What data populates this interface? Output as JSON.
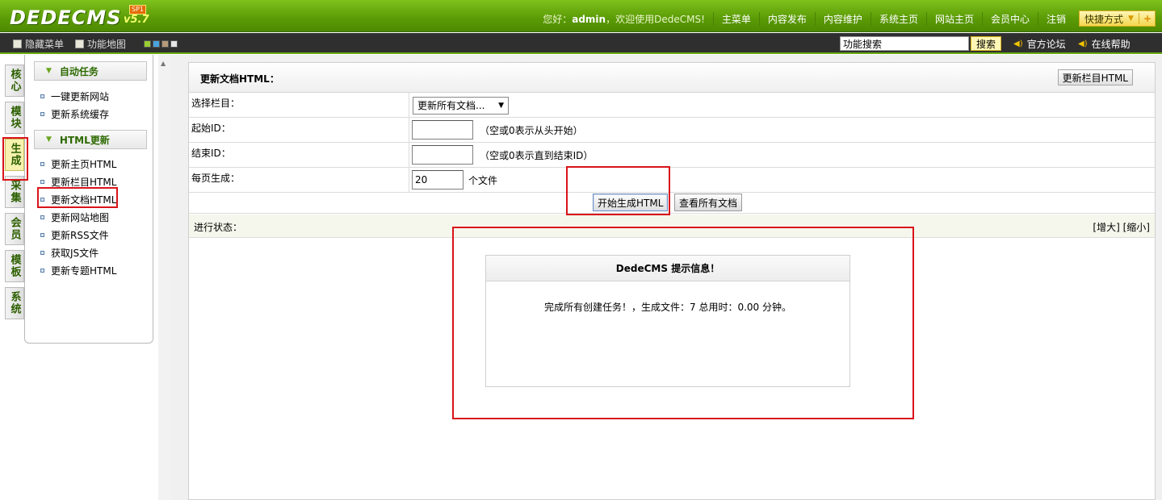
{
  "topbar": {
    "logo_text": "DEDECMS",
    "logo_version": "v5.7",
    "logo_badge": "SP1",
    "greeting_prefix": "您好：",
    "greeting_user": "admin",
    "greeting_suffix": "，欢迎使用DedeCMS!",
    "nav": [
      "主菜单",
      "内容发布",
      "内容维护",
      "系统主页",
      "网站主页",
      "会员中心",
      "注销"
    ],
    "quick_label": "快捷方式"
  },
  "subbar": {
    "hide_menu": "隐藏菜单",
    "func_map": "功能地图",
    "skin_colors": [
      "#9acd32",
      "#4aa3df",
      "#b59a7a",
      "#e6e6e6"
    ],
    "search_value": "功能搜索",
    "search_button": "搜索",
    "forum": "官方论坛",
    "help": "在线帮助"
  },
  "vtabs": [
    "核心",
    "模块",
    "生成",
    "采集",
    "会员",
    "模板",
    "系统"
  ],
  "active_vtab": "生成",
  "menu": {
    "groups": [
      {
        "title": "自动任务",
        "items": [
          "一键更新网站",
          "更新系统缓存"
        ]
      },
      {
        "title": "HTML更新",
        "items": [
          "更新主页HTML",
          "更新栏目HTML",
          "更新文档HTML",
          "更新网站地图",
          "更新RSS文件",
          "获取JS文件",
          "更新专题HTML"
        ]
      }
    ]
  },
  "main": {
    "title": "更新文档HTML：",
    "update_column_button": "更新栏目HTML",
    "form": {
      "column_label": "选择栏目：",
      "column_selected": "更新所有文档...",
      "start_label": "起始ID：",
      "start_value": "",
      "start_hint": "（空或0表示从头开始）",
      "end_label": "结束ID：",
      "end_value": "",
      "end_hint": "（空或0表示直到结束ID）",
      "perpage_label": "每页生成：",
      "perpage_value": "20",
      "perpage_unit": "个文件"
    },
    "start_button": "开始生成HTML",
    "view_all_button": "查看所有文档",
    "status_label": "进行状态：",
    "enlarge": "[增大]",
    "shrink": "[缩小]",
    "message": {
      "title": "DedeCMS 提示信息！",
      "body": "完成所有创建任务！，生成文件：7 总用时：0.00 分钟。"
    }
  }
}
